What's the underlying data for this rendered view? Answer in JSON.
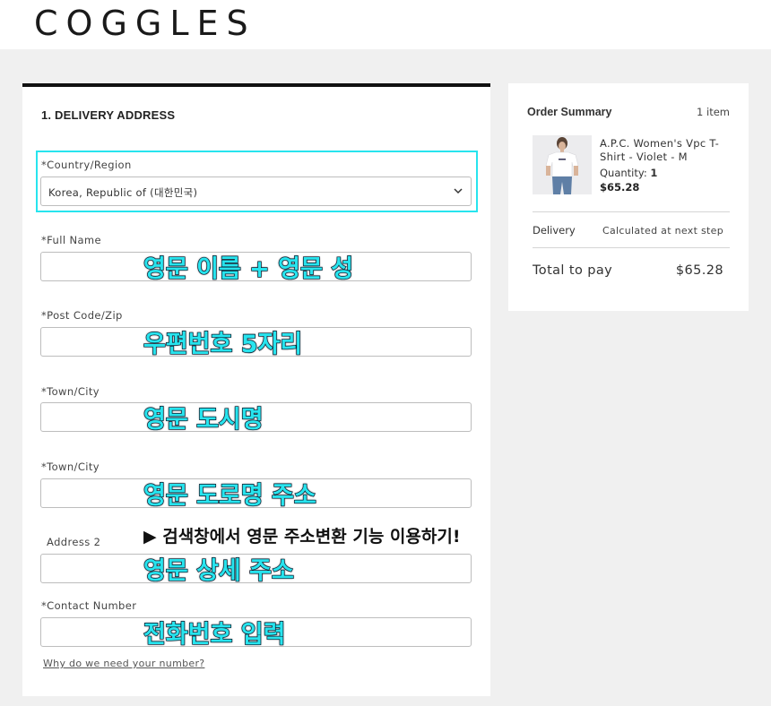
{
  "brand": {
    "logo_text": "COGGLES"
  },
  "form": {
    "section_title": "1. DELIVERY ADDRESS",
    "country": {
      "label": "*Country/Region",
      "value": "Korea, Republic of (대한민국)"
    },
    "full_name": {
      "label": "*Full Name",
      "value": ""
    },
    "post_code": {
      "label": "*Post Code/Zip",
      "value": ""
    },
    "town_city": {
      "label": "*Town/City",
      "value": ""
    },
    "address_1": {
      "label": "*Town/City",
      "value": ""
    },
    "address_2": {
      "label": "Address 2",
      "value": ""
    },
    "contact": {
      "label": "*Contact Number",
      "value": ""
    },
    "why_link": "Why do we need your number?"
  },
  "annotations": {
    "full_name": "영문 이름 + 영문 성",
    "post_code": "우편번호 5자리",
    "town_city": "영문 도시명",
    "address_1": "영문 도로명 주소",
    "tip": "▶ 검색창에서 영문 주소변환 기능 이용하기!",
    "address_2": "영문 상세 주소",
    "contact": "전화번호 입력",
    "overlay_color": "#27e4ee",
    "highlight_color": "#27e4ee"
  },
  "summary": {
    "title": "Order Summary",
    "item_count": "1 item",
    "product": {
      "name": "A.P.C. Women's Vpc T-Shirt - Violet - M",
      "quantity_label": "Quantity:",
      "quantity": "1",
      "price": "$65.28"
    },
    "delivery_label": "Delivery",
    "delivery_value": "Calculated at next step",
    "total_label": "Total to pay",
    "total_value": "$65.28"
  }
}
